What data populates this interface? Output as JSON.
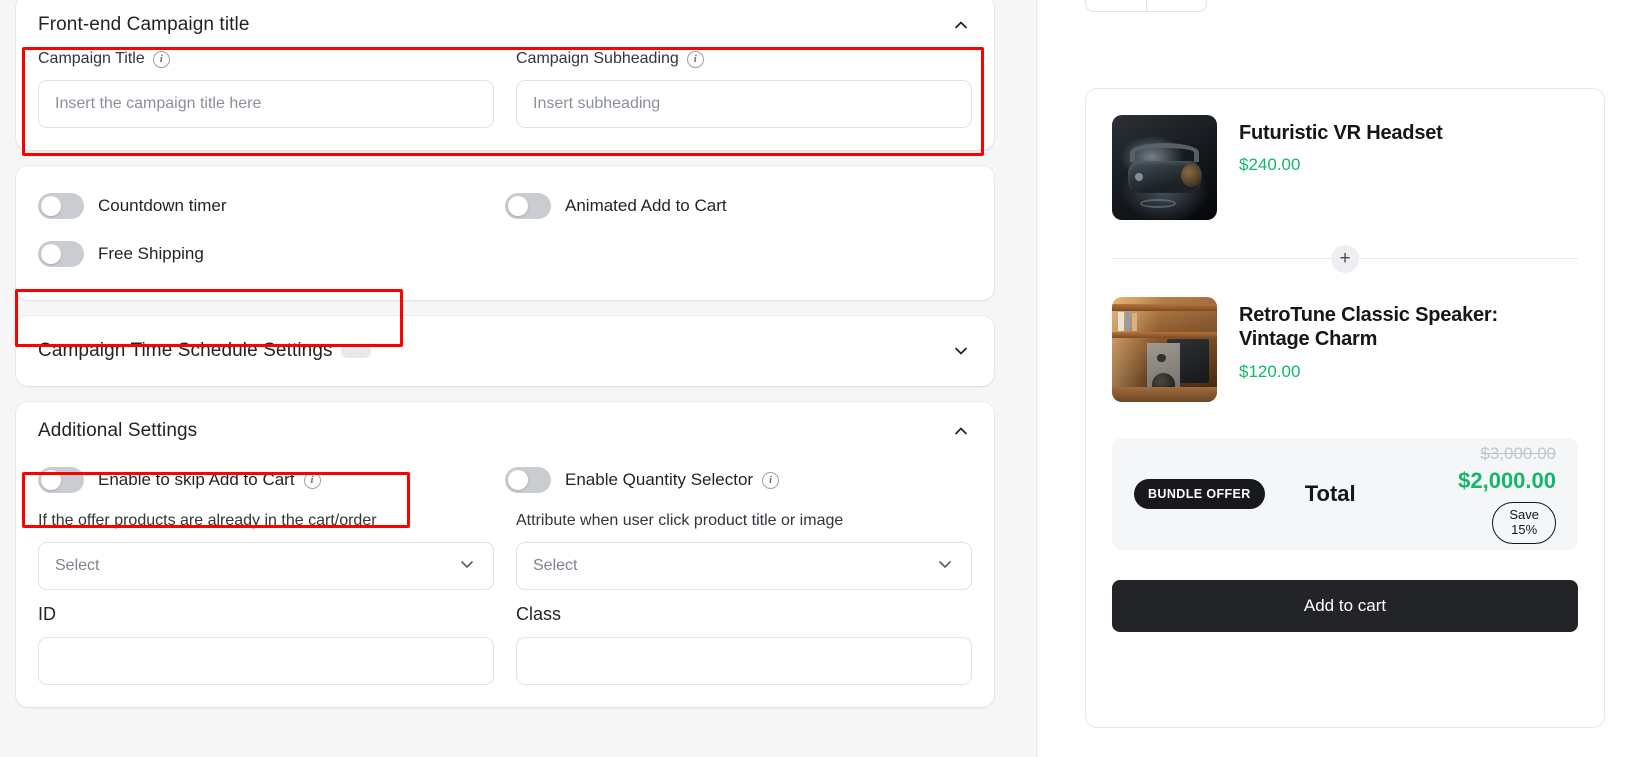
{
  "settings_panel": {
    "sections": [
      {
        "id": "frontend-campaign-title",
        "title": "Front-end Campaign title",
        "chevron": "chevron-up-icon",
        "fields": [
          {
            "label": "Campaign Title",
            "info": "info-icon",
            "placeholder": "Insert the campaign title here",
            "value": ""
          },
          {
            "label": "Campaign Subheading",
            "info": "info-icon",
            "placeholder": "Insert subheading",
            "value": ""
          }
        ]
      },
      {
        "id": "feature-toggles",
        "toggles": [
          {
            "label": "Countdown timer",
            "state": "off"
          },
          {
            "label": "Animated Add to Cart",
            "state": "off"
          },
          {
            "label": "Free Shipping",
            "state": "off"
          }
        ]
      },
      {
        "id": "campaign-time-schedule",
        "title": "Campaign Time Schedule Settings",
        "chevron": "chevron-down-icon",
        "has_inline_switch": true
      },
      {
        "id": "additional-settings",
        "title": "Additional Settings",
        "chevron": "chevron-up-icon",
        "toggles": [
          {
            "label": "Enable to skip Add to Cart",
            "info": "info-icon",
            "state": "off"
          },
          {
            "label": "Enable Quantity Selector",
            "info": "info-icon",
            "state": "off"
          }
        ],
        "selects": [
          {
            "label": "If the offer products are already in the cart/order",
            "value": "Select"
          },
          {
            "label": "Attribute when user click product title or image",
            "value": "Select"
          }
        ],
        "inputs": [
          {
            "label": "ID",
            "value": ""
          },
          {
            "label": "Class",
            "value": ""
          }
        ]
      }
    ]
  },
  "preview_panel": {
    "products": [
      {
        "name": "Futuristic VR Headset",
        "price": "$240.00",
        "image": "vr-headset-photo"
      },
      {
        "name": "RetroTune Classic Speaker: Vintage Charm",
        "price": "$120.00",
        "image": "vintage-speaker-photo"
      }
    ],
    "plus_separator": "plus-icon",
    "bundle": {
      "badge": "BUNDLE OFFER",
      "total_label": "Total",
      "original_price": "$3,000.00",
      "discounted_price": "$2,000.00",
      "save_line1": "Save",
      "save_line2": "15%"
    },
    "add_to_cart_label": "Add to cart"
  },
  "colors": {
    "accent_green": "#12b76a",
    "annotation_red": "#ff0000",
    "dark_button": "#222427",
    "muted_text": "#8a9099"
  }
}
